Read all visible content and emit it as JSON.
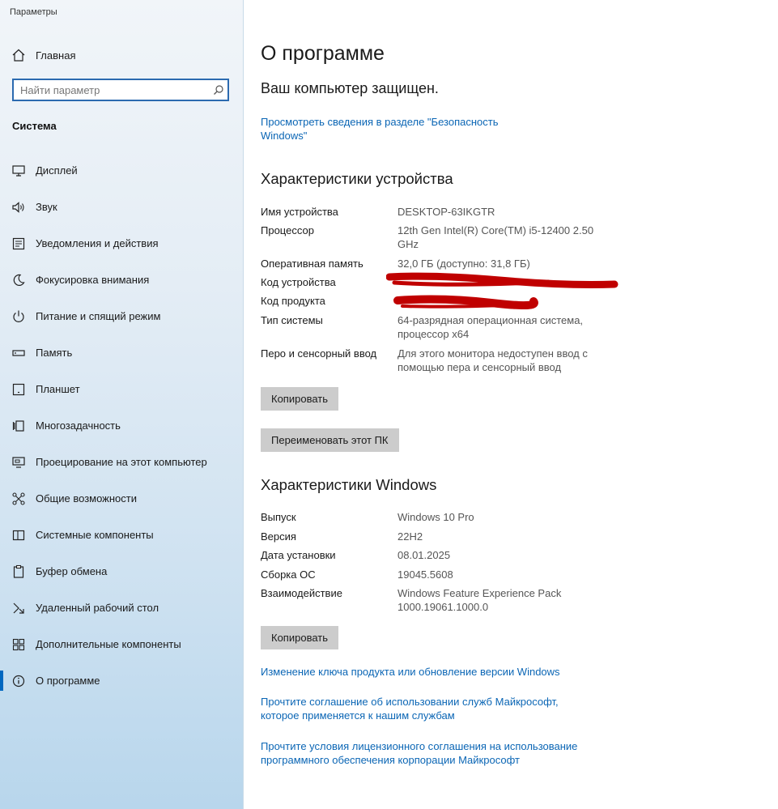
{
  "window": {
    "title": "Параметры"
  },
  "sidebar": {
    "home_label": "Главная",
    "search_placeholder": "Найти параметр",
    "section_title": "Система",
    "items": [
      {
        "label": "Дисплей",
        "icon": "display-icon"
      },
      {
        "label": "Звук",
        "icon": "speaker-icon"
      },
      {
        "label": "Уведомления и действия",
        "icon": "notification-icon"
      },
      {
        "label": "Фокусировка внимания",
        "icon": "moon-icon"
      },
      {
        "label": "Питание и спящий режим",
        "icon": "power-icon"
      },
      {
        "label": "Память",
        "icon": "storage-icon"
      },
      {
        "label": "Планшет",
        "icon": "tablet-icon"
      },
      {
        "label": "Многозадачность",
        "icon": "multitasking-icon"
      },
      {
        "label": "Проецирование на этот компьютер",
        "icon": "projection-icon"
      },
      {
        "label": "Общие возможности",
        "icon": "shared-experiences-icon"
      },
      {
        "label": "Системные компоненты",
        "icon": "system-components-icon"
      },
      {
        "label": "Буфер обмена",
        "icon": "clipboard-icon"
      },
      {
        "label": "Удаленный рабочий стол",
        "icon": "remote-desktop-icon"
      },
      {
        "label": "Дополнительные компоненты",
        "icon": "optional-features-icon"
      },
      {
        "label": "О программе",
        "icon": "info-icon",
        "active": true
      }
    ]
  },
  "main": {
    "title": "О программе",
    "protected_text": "Ваш компьютер защищен.",
    "security_link": "Просмотреть сведения в разделе \"Безопасность Windows\"",
    "device_specs": {
      "heading": "Характеристики устройства",
      "rows": [
        {
          "key": "Имя устройства",
          "value": "DESKTOP-63IKGTR"
        },
        {
          "key": "Процессор",
          "value": "12th Gen Intel(R) Core(TM) i5-12400   2.50 GHz"
        },
        {
          "key": "Оперативная память",
          "value": "32,0 ГБ (доступно: 31,8 ГБ)"
        },
        {
          "key": "Код устройства",
          "value": ""
        },
        {
          "key": "Код продукта",
          "value": ""
        },
        {
          "key": "Тип системы",
          "value": "64-разрядная операционная система, процессор x64"
        },
        {
          "key": "Перо и сенсорный ввод",
          "value": "Для этого монитора недоступен ввод с помощью пера и сенсорный ввод"
        }
      ],
      "copy_button": "Копировать",
      "rename_button": "Переименовать этот ПК"
    },
    "windows_specs": {
      "heading": "Характеристики Windows",
      "rows": [
        {
          "key": "Выпуск",
          "value": "Windows 10 Pro"
        },
        {
          "key": "Версия",
          "value": "22H2"
        },
        {
          "key": "Дата установки",
          "value": "08.01.2025"
        },
        {
          "key": "Сборка ОС",
          "value": "19045.5608"
        },
        {
          "key": "Взаимодействие",
          "value": "Windows Feature Experience Pack 1000.19061.1000.0"
        }
      ],
      "copy_button": "Копировать"
    },
    "links": [
      "Изменение ключа продукта или обновление версии Windows",
      "Прочтите соглашение об использовании служб Майкрософт, которое применяется к нашим службам",
      "Прочтите условия лицензионного соглашения на использование программного обеспечения корпорации Майкрософт"
    ]
  },
  "colors": {
    "accent": "#0067c0",
    "link": "#0b66b5",
    "redaction": "#c00000"
  }
}
